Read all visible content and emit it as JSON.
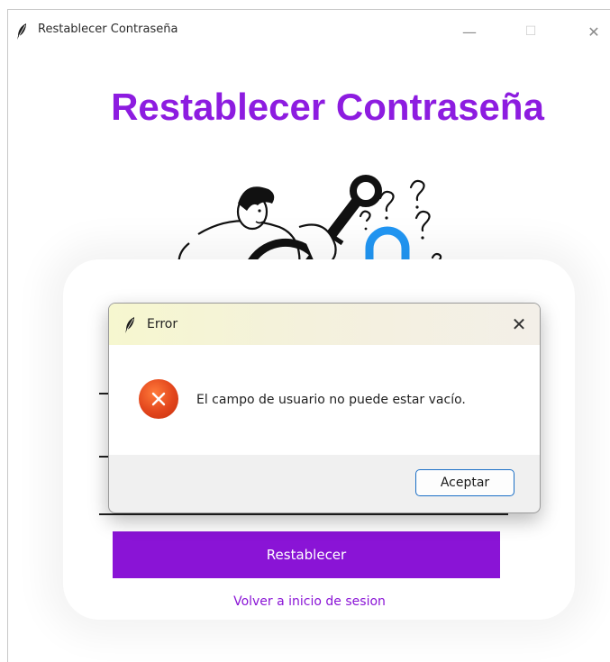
{
  "window": {
    "title": "Restablecer Contraseña",
    "icon": "feather-icon",
    "controls": {
      "minimize": "—",
      "maximize": "☐",
      "close": "✕"
    }
  },
  "page": {
    "heading": "Restablecer Contraseña",
    "illustration": "person-with-key-and-padlock",
    "reset_button": "Restablecer",
    "back_link": "Volver a inicio de sesion"
  },
  "dialog": {
    "title": "Error",
    "icon": "feather-icon",
    "close": "✕",
    "message": "El campo de usuario no puede estar vacío.",
    "error_icon": "error-x-icon",
    "ok_button": "Aceptar"
  },
  "colors": {
    "accent": "#8a14d6",
    "heading": "#8d1ce0",
    "error": "#e2451c",
    "padlock": "#2196f3"
  }
}
